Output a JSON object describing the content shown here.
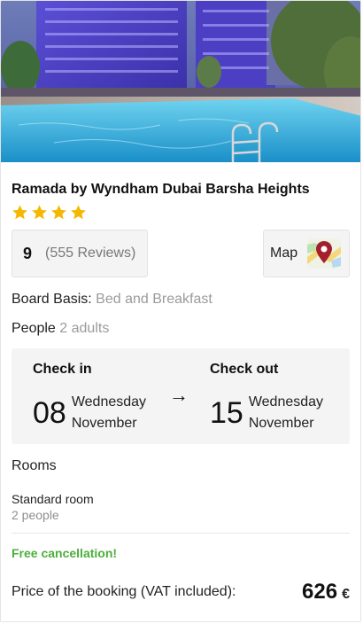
{
  "hotel": {
    "name": "Ramada by Wyndham Dubai Barsha Heights",
    "stars": 4,
    "rating_score": "9",
    "reviews": "(555 Reviews)",
    "map_label": "Map"
  },
  "board": {
    "label": "Board Basis:",
    "value": "Bed and Breakfast"
  },
  "people": {
    "label": "People",
    "value": "2 adults"
  },
  "dates": {
    "check_in": {
      "title": "Check in",
      "day": "08",
      "weekday": "Wednesday",
      "month": "November"
    },
    "arrow": "→",
    "check_out": {
      "title": "Check out",
      "day": "15",
      "weekday": "Wednesday",
      "month": "November"
    }
  },
  "rooms": {
    "title": "Rooms",
    "items": [
      {
        "name": "Standard room",
        "people": "2 people"
      }
    ]
  },
  "cancellation": "Free cancellation!",
  "price": {
    "label": "Price of the booking (VAT included):",
    "value": "626",
    "currency": "€"
  },
  "colors": {
    "star": "#f5b800",
    "free_cancel": "#4caf3a",
    "box_bg": "#f4f4f4"
  },
  "icons": {
    "star": "star-icon",
    "map": "map-pin-icon"
  }
}
